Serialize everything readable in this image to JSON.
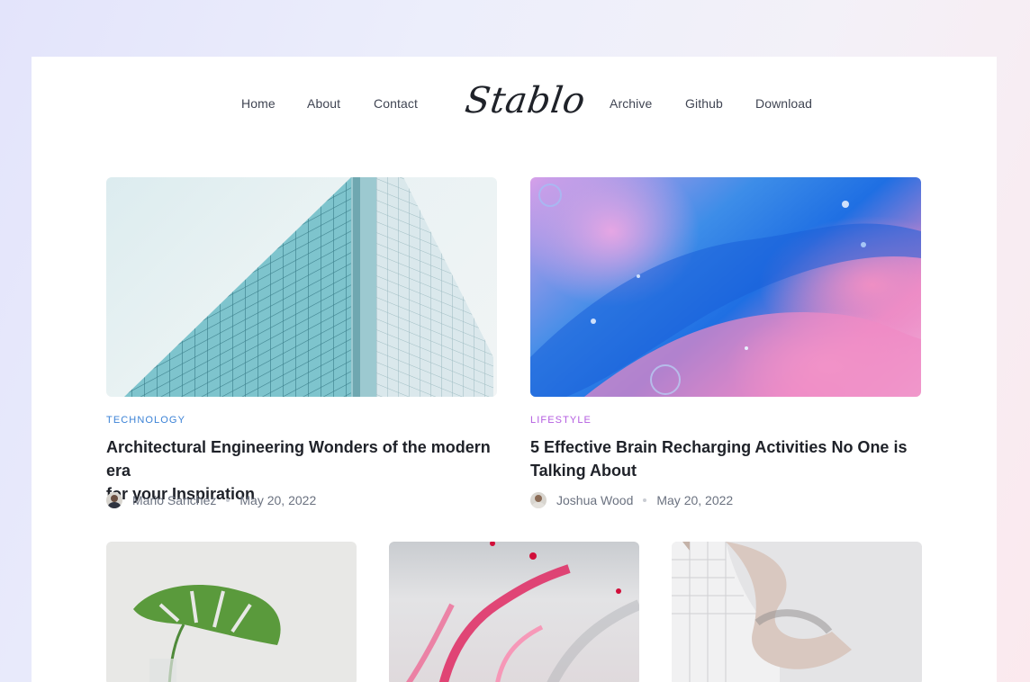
{
  "nav": {
    "left": [
      "Home",
      "About",
      "Contact"
    ],
    "logo": "Stablo",
    "right": [
      "Archive",
      "Github",
      "Download"
    ]
  },
  "posts": [
    {
      "category": "TECHNOLOGY",
      "category_color": "#3b82d6",
      "title_line1": "Architectural Engineering Wonders of the modern era",
      "title_line2": "for your Inspiration",
      "author": "Mario Sanchez",
      "date": "May 20, 2022",
      "image": "glass-building-image"
    },
    {
      "category": "LIFESTYLE",
      "category_color": "#b45de0",
      "title_line1": "5 Effective Brain Recharging Activities No One is",
      "title_line2": "Talking About",
      "author": "Joshua Wood",
      "date": "May 20, 2022",
      "image": "liquid-paint-image"
    },
    {
      "image": "monstera-leaf-image"
    },
    {
      "image": "pink-marble-image"
    },
    {
      "image": "white-building-image"
    }
  ]
}
